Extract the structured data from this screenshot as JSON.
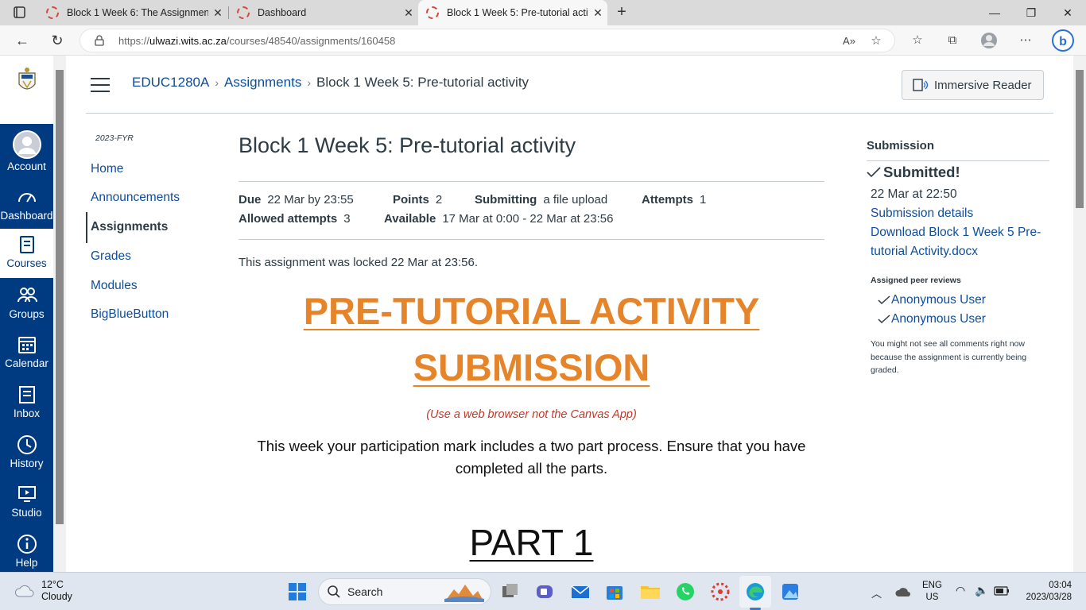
{
  "browser": {
    "tabs": [
      {
        "title": "Block 1 Week 6: The Assignment",
        "active": false
      },
      {
        "title": "Dashboard",
        "active": false
      },
      {
        "title": "Block 1 Week 5: Pre-tutorial activ",
        "active": true
      }
    ],
    "url_prefix": "https://",
    "url_host": "ulwazi.wits.ac.za",
    "url_path": "/courses/48540/assignments/160458"
  },
  "global_nav": {
    "logo_text": "UNIVERSITY OF THE WITWATERSRAND, JOHANNESBURG",
    "items": [
      {
        "label": "Account",
        "icon": "account-avatar-icon"
      },
      {
        "label": "Dashboard",
        "icon": "dashboard-gauge-icon"
      },
      {
        "label": "Courses",
        "icon": "courses-book-icon"
      },
      {
        "label": "Groups",
        "icon": "groups-people-icon"
      },
      {
        "label": "Calendar",
        "icon": "calendar-icon"
      },
      {
        "label": "Inbox",
        "icon": "inbox-icon"
      },
      {
        "label": "History",
        "icon": "history-clock-icon"
      },
      {
        "label": "Studio",
        "icon": "studio-icon"
      },
      {
        "label": "Help",
        "icon": "help-info-icon"
      }
    ]
  },
  "header": {
    "breadcrumbs": [
      "EDUC1280A",
      "Assignments",
      "Block 1 Week 5: Pre-tutorial activity"
    ],
    "immersive_reader": "Immersive Reader"
  },
  "course_nav": {
    "term": "2023-FYR",
    "items": [
      "Home",
      "Announcements",
      "Assignments",
      "Grades",
      "Modules",
      "BigBlueButton"
    ],
    "active": "Assignments"
  },
  "assignment": {
    "title": "Block 1 Week 5: Pre-tutorial activity",
    "due_label": "Due",
    "due_value": "22 Mar by 23:55",
    "points_label": "Points",
    "points_value": "2",
    "submitting_label": "Submitting",
    "submitting_value": "a file upload",
    "attempts_label": "Attempts",
    "attempts_value": "1",
    "allowed_label": "Allowed attempts",
    "allowed_value": "3",
    "available_label": "Available",
    "available_value": "17 Mar at 0:00 - 22 Mar at 23:56",
    "locked_notice": "This assignment was locked 22 Mar at 23:56.",
    "heading_line1": "PRE-TUTORIAL ACTIVITY",
    "heading_line2": "SUBMISSION",
    "browser_note": "(Use a web browser not the Canvas App)",
    "intro": "This week your participation mark includes a two part process. Ensure that you have completed all the parts.",
    "part_heading": "PART 1"
  },
  "sidebar": {
    "heading": "Submission",
    "status": "Submitted!",
    "submitted_at": "22 Mar at 22:50",
    "details_link": "Submission details",
    "download_link_line1": "Download Block 1 Week 5 Pre-",
    "download_link_line2": "tutorial Activity.docx",
    "peer_heading": "Assigned peer reviews",
    "peer_reviews": [
      "Anonymous User",
      "Anonymous User"
    ],
    "note": "You might not see all comments right now because the assignment is currently being graded."
  },
  "taskbar": {
    "temp": "12°C",
    "condition": "Cloudy",
    "search": "Search",
    "lang_line1": "ENG",
    "lang_line2": "US",
    "time": "03:04",
    "date": "2023/03/28"
  },
  "colors": {
    "nav_bg": "#003a80",
    "link": "#0e4d9c",
    "heading_orange": "#e6842a",
    "note_red": "#c0392b"
  }
}
